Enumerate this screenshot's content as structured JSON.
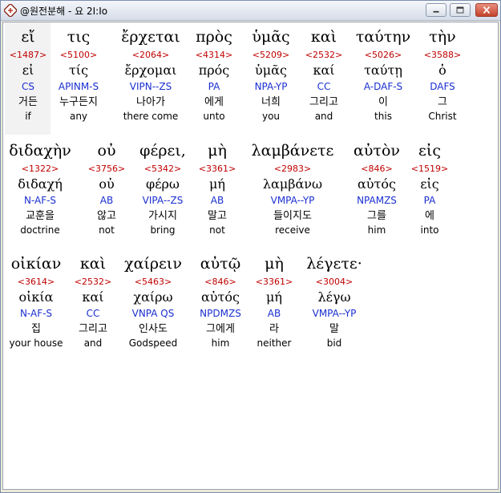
{
  "window": {
    "title": "@원전분해 - 요 2I:Io",
    "icon": "bible-app-icon",
    "controls": {
      "minimize": "minimize-icon",
      "maximize": "maximize-icon",
      "close": "close-icon"
    },
    "close_color": "#c4432c"
  },
  "colors": {
    "strongs": "#c00000",
    "parsing": "#1a2fd0",
    "text": "#000000",
    "selection": "#f2f2f2"
  },
  "rows": [
    {
      "words": [
        {
          "greek": "εἴ",
          "strongs": "<1487>",
          "lemma": "εἰ",
          "parse": "CS",
          "korean": "거든",
          "english": "if"
        },
        {
          "greek": "τις",
          "strongs": "<5100>",
          "lemma": "τίς",
          "parse": "APINM-S",
          "korean": "누구든지",
          "english": "any"
        },
        {
          "greek": "ἔρχεται",
          "strongs": "<2064>",
          "lemma": "ἔρχομαι",
          "parse": "VIPN--ZS",
          "korean": "나아가",
          "english": "there come"
        },
        {
          "greek": "πρὸς",
          "strongs": "<4314>",
          "lemma": "πρός",
          "parse": "PA",
          "korean": "에게",
          "english": "unto"
        },
        {
          "greek": "ὑμᾶς",
          "strongs": "<5209>",
          "lemma": "ὑμᾶς",
          "parse": "NPA-YP",
          "korean": "너희",
          "english": "you"
        },
        {
          "greek": "καὶ",
          "strongs": "<2532>",
          "lemma": "καί",
          "parse": "CC",
          "korean": "그리고",
          "english": "and"
        },
        {
          "greek": "ταύτην",
          "strongs": "<5026>",
          "lemma": "ταύτῃ",
          "parse": "A-DAF-S",
          "korean": "이",
          "english": "this"
        },
        {
          "greek": "τὴν",
          "strongs": "<3588>",
          "lemma": "ὁ",
          "parse": "DAFS",
          "korean": "그",
          "english": "Christ"
        }
      ]
    },
    {
      "words": [
        {
          "greek": "διδαχὴν",
          "strongs": "<1322>",
          "lemma": "διδαχή",
          "parse": "N-AF-S",
          "korean": "교훈을",
          "english": "doctrine"
        },
        {
          "greek": "οὐ",
          "strongs": "<3756>",
          "lemma": "οὐ",
          "parse": "AB",
          "korean": "않고",
          "english": "not"
        },
        {
          "greek": "φέρει,",
          "strongs": "<5342>",
          "lemma": "φέρω",
          "parse": "VIPA--ZS",
          "korean": "가시지",
          "english": "bring"
        },
        {
          "greek": "μὴ",
          "strongs": "<3361>",
          "lemma": "μή",
          "parse": "AB",
          "korean": "말고",
          "english": "not"
        },
        {
          "greek": "λαμβάνετε",
          "strongs": "<2983>",
          "lemma": "λαμβάνω",
          "parse": "VMPA--YP",
          "korean": "들이지도",
          "english": "receive"
        },
        {
          "greek": "αὐτὸν",
          "strongs": "<846>",
          "lemma": "αὐτός",
          "parse": "NPAMZS",
          "korean": "그를",
          "english": "him"
        },
        {
          "greek": "εἰς",
          "strongs": "<1519>",
          "lemma": "εἰς",
          "parse": "PA",
          "korean": "에",
          "english": "into"
        }
      ]
    },
    {
      "words": [
        {
          "greek": "οἰκίαν",
          "strongs": "<3614>",
          "lemma": "οἰκία",
          "parse": "N-AF-S",
          "korean": "집",
          "english": "your house"
        },
        {
          "greek": "καὶ",
          "strongs": "<2532>",
          "lemma": "καί",
          "parse": "CC",
          "korean": "그리고",
          "english": "and"
        },
        {
          "greek": "χαίρειν",
          "strongs": "<5463>",
          "lemma": "χαίρω",
          "parse": "VNPA QS",
          "korean": "인사도",
          "english": "Godspeed"
        },
        {
          "greek": "αὐτῷ",
          "strongs": "<846>",
          "lemma": "αὐτός",
          "parse": "NPDMZS",
          "korean": "그에게",
          "english": "him"
        },
        {
          "greek": "μὴ",
          "strongs": "<3361>",
          "lemma": "μή",
          "parse": "AB",
          "korean": "라",
          "english": "neither"
        },
        {
          "greek": "λέγετε·",
          "strongs": "<3004>",
          "lemma": "λέγω",
          "parse": "VMPA--YP",
          "korean": "말",
          "english": "bid"
        }
      ]
    }
  ]
}
